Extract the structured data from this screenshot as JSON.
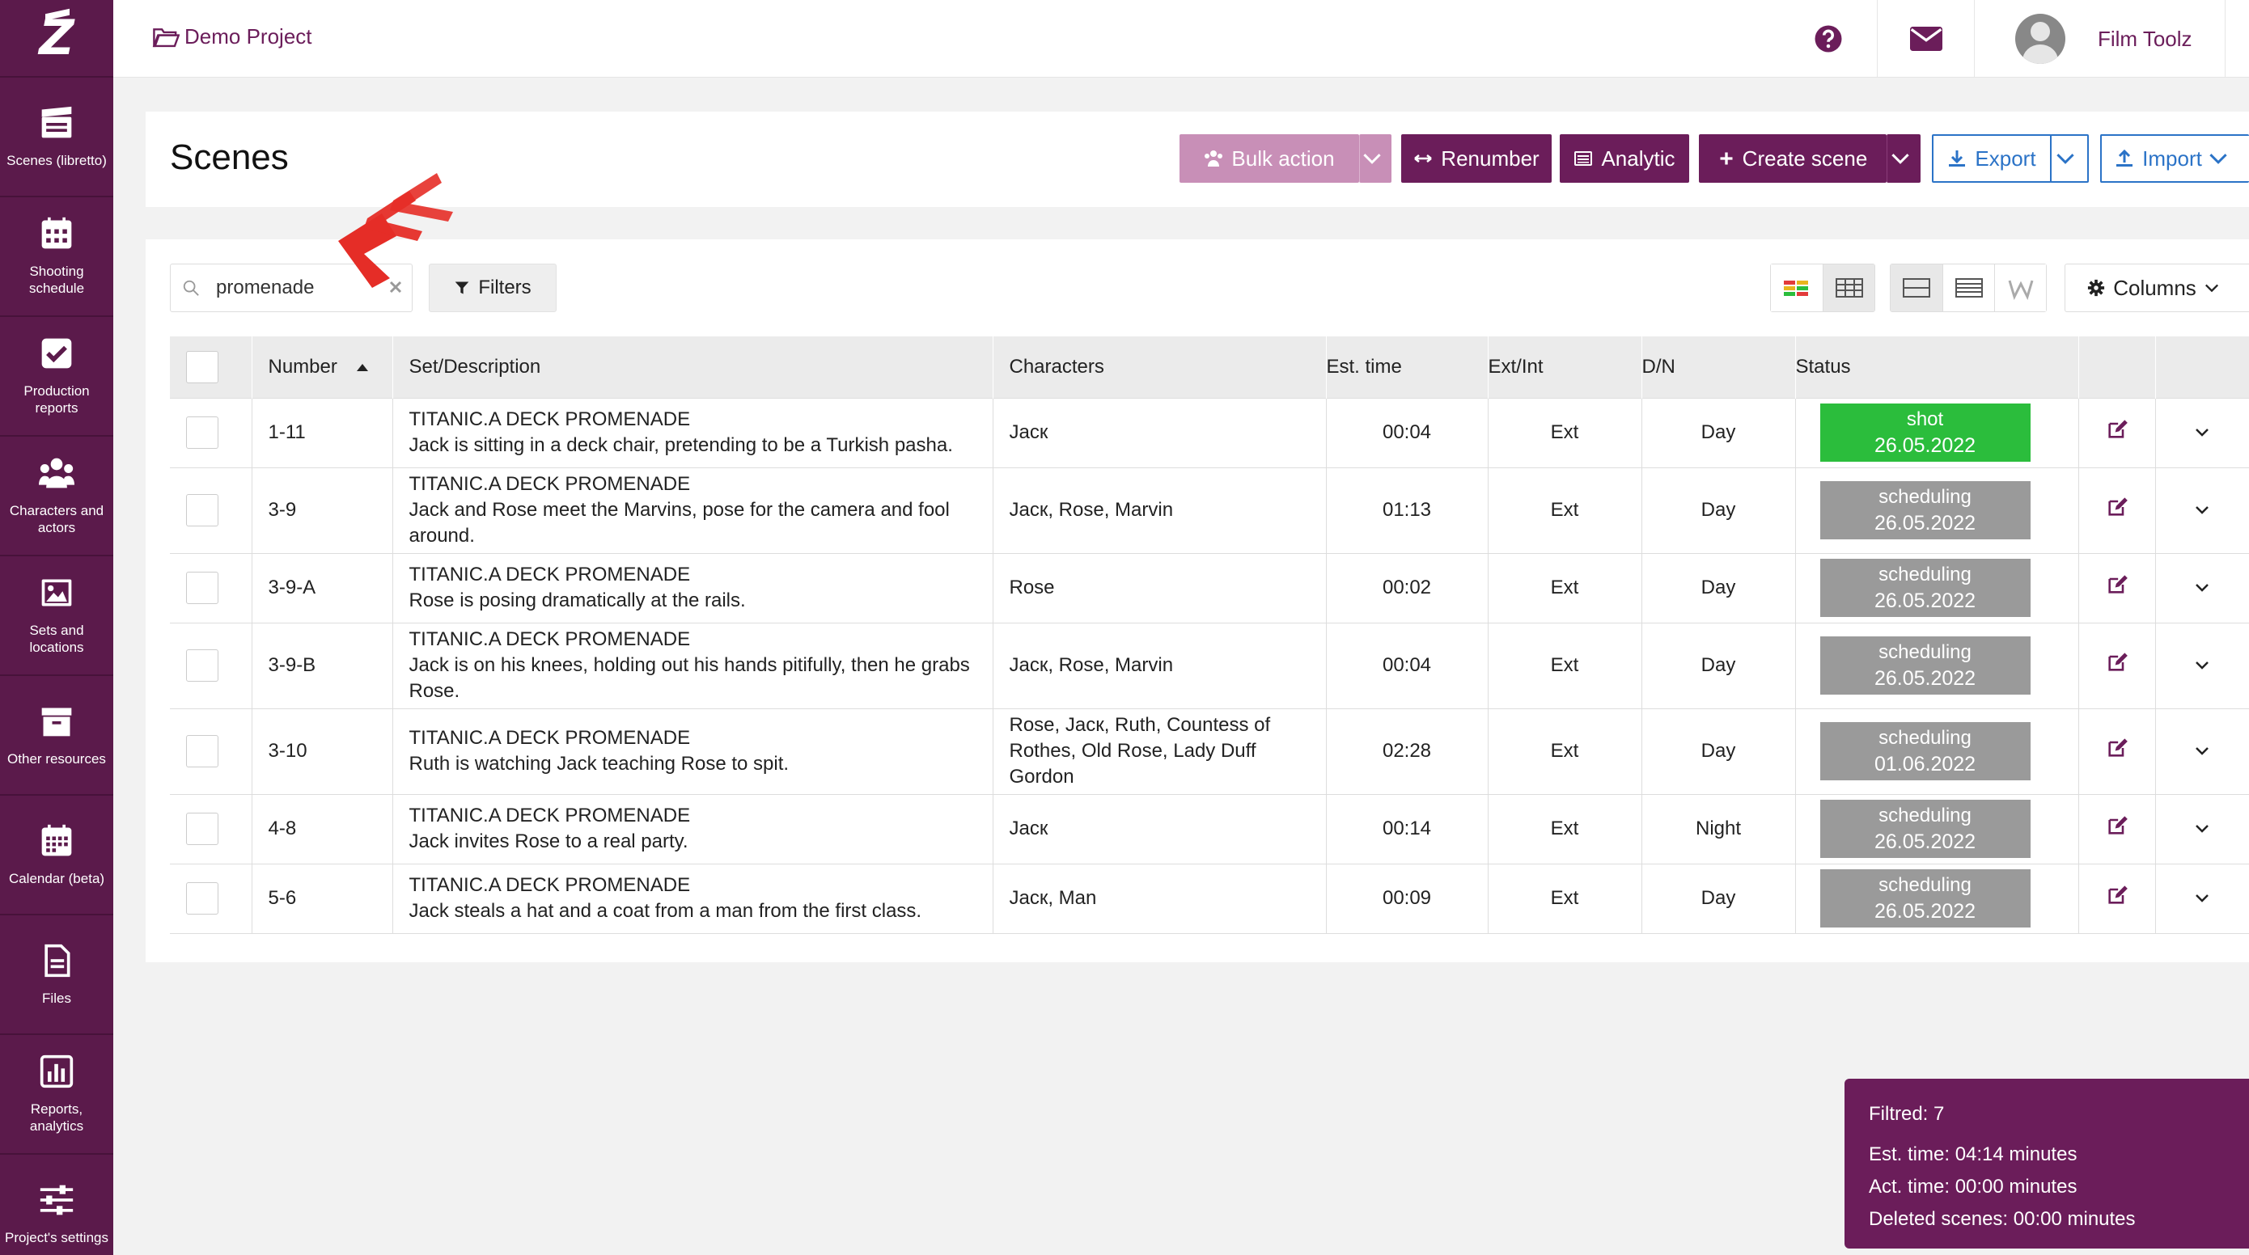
{
  "sidebar": {
    "items": [
      {
        "label": "Scenes (libretto)",
        "icon": "clapperboard-icon"
      },
      {
        "label": "Shooting schedule",
        "icon": "calendar-grid-icon"
      },
      {
        "label": "Production reports",
        "icon": "check-square-icon"
      },
      {
        "label": "Characters and actors",
        "icon": "users-icon"
      },
      {
        "label": "Sets and locations",
        "icon": "image-icon"
      },
      {
        "label": "Other resources",
        "icon": "archive-icon"
      },
      {
        "label": "Calendar (beta)",
        "icon": "calendar-icon"
      },
      {
        "label": "Files",
        "icon": "file-icon"
      },
      {
        "label": "Reports, analytics",
        "icon": "bar-chart-icon"
      },
      {
        "label": "Project's settings",
        "icon": "sliders-icon"
      }
    ]
  },
  "topbar": {
    "project": "Demo Project",
    "username": "Film Toolz"
  },
  "header": {
    "title": "Scenes",
    "bulk_action": "Bulk action",
    "renumber": "Renumber",
    "analytic": "Analytic",
    "create_scene": "Create scene",
    "export": "Export",
    "import": "Import"
  },
  "toolbar": {
    "search_value": "promenade",
    "filters": "Filters",
    "columns": "Columns"
  },
  "table": {
    "headers": {
      "number": "Number",
      "set": "Set/Description",
      "characters": "Characters",
      "est_time": "Est. time",
      "ext_int": "Ext/Int",
      "dn": "D/N",
      "status": "Status"
    },
    "rows": [
      {
        "number": "1-11",
        "set": "TITANIC.A DECK PROMENADE",
        "desc": "Jack is sitting in a deck chair, pretending to be a Turkish pasha.",
        "characters": "Jacк",
        "est": "00:04",
        "extint": "Ext",
        "dn": "Day",
        "status": "shot",
        "date": "26.05.2022"
      },
      {
        "number": "3-9",
        "set": "TITANIC.A DECK PROMENADE",
        "desc": "Jack and Rose meet the Marvins, pose for the camera and fool around.",
        "characters": "Jacк, Rose, Marvin",
        "est": "01:13",
        "extint": "Ext",
        "dn": "Day",
        "status": "scheduling",
        "date": "26.05.2022"
      },
      {
        "number": "3-9-A",
        "set": "TITANIC.A DECK PROMENADE",
        "desc": "Rose is posing dramatically at the rails.",
        "characters": "Rose",
        "est": "00:02",
        "extint": "Ext",
        "dn": "Day",
        "status": "scheduling",
        "date": "26.05.2022"
      },
      {
        "number": "3-9-B",
        "set": "TITANIC.A DECK PROMENADE",
        "desc": "Jack is on his knees, holding out his hands pitifully, then he grabs Rose.",
        "characters": "Jacк, Rose, Marvin",
        "est": "00:04",
        "extint": "Ext",
        "dn": "Day",
        "status": "scheduling",
        "date": "26.05.2022"
      },
      {
        "number": "3-10",
        "set": "TITANIC.A DECK PROMENADE",
        "desc": "Ruth is watching Jack teaching Rose to spit.",
        "characters": "Rose, Jacк, Ruth, Countess of Rothes, Old Rose, Lady Duff Gordon",
        "est": "02:28",
        "extint": "Ext",
        "dn": "Day",
        "status": "scheduling",
        "date": "01.06.2022"
      },
      {
        "number": "4-8",
        "set": "TITANIC.A DECK PROMENADE",
        "desc": "Jack invites Rose to a real party.",
        "characters": "Jacк",
        "est": "00:14",
        "extint": "Ext",
        "dn": "Night",
        "status": "scheduling",
        "date": "26.05.2022"
      },
      {
        "number": "5-6",
        "set": "TITANIC.A DECK PROMENADE",
        "desc": "Jack steals a hat and a coat from a man from the first class.",
        "characters": "Jacк, Man",
        "est": "00:09",
        "extint": "Ext",
        "dn": "Day",
        "status": "scheduling",
        "date": "26.05.2022"
      }
    ]
  },
  "summary": {
    "filtered": "Filtred: 7",
    "est_time": "Est. time: 04:14 minutes",
    "act_time": "Act. time: 00:00 minutes",
    "deleted": "Deleted scenes: 00:00 minutes"
  },
  "colors": {
    "brand": "#6b1d5a",
    "sidebar": "#5b1a4b",
    "shot": "#2bbd3c",
    "scheduling": "#9a9a9a",
    "link": "#2b73c7"
  }
}
